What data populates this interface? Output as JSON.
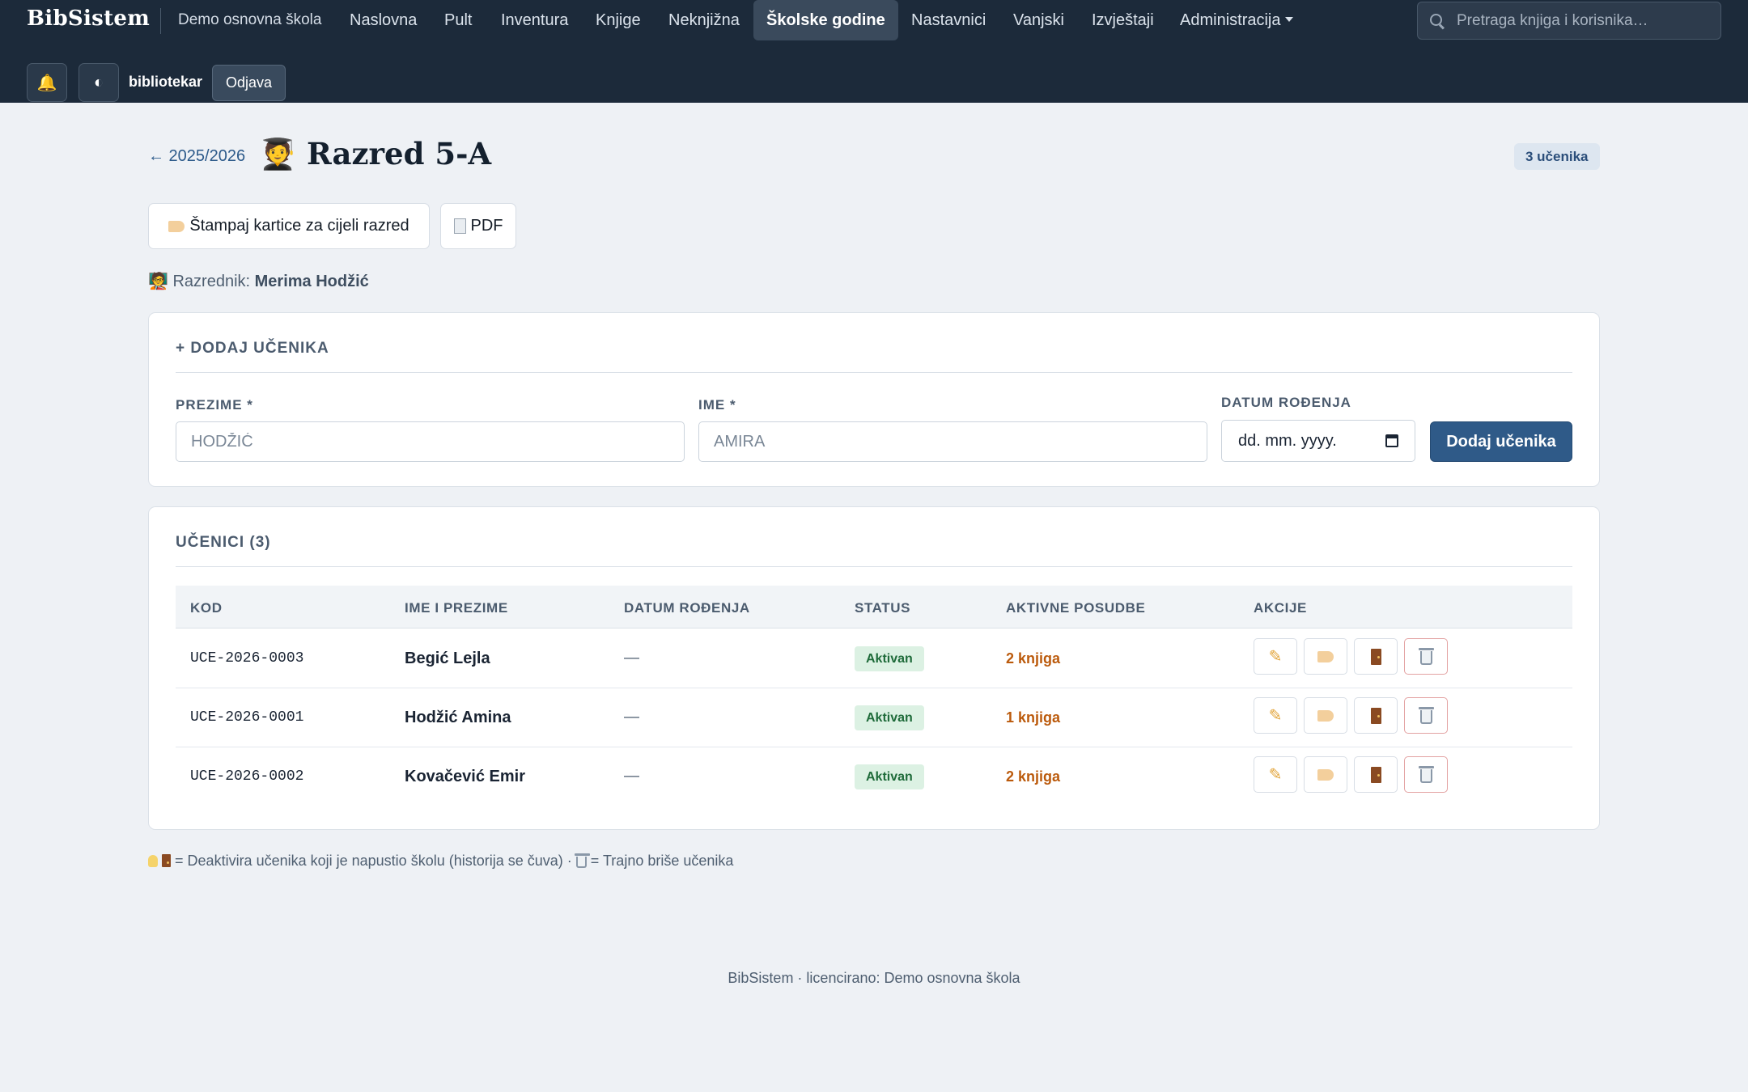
{
  "app": {
    "brand": "BibSistem",
    "school": "Demo osnovna škola"
  },
  "nav": {
    "items": [
      {
        "label": "Naslovna"
      },
      {
        "label": "Pult"
      },
      {
        "label": "Inventura"
      },
      {
        "label": "Knjige"
      },
      {
        "label": "Neknjižna"
      },
      {
        "label": "Školske godine"
      },
      {
        "label": "Nastavnici"
      },
      {
        "label": "Vanjski"
      },
      {
        "label": "Izvještaji"
      },
      {
        "label": "Administracija"
      }
    ],
    "active": "Školske godine",
    "search_placeholder": "Pretraga knjiga i korisnika…"
  },
  "user_bar": {
    "notifications_icon": "bell-icon",
    "theme_icon": "contrast-icon",
    "username": "bibliotekar",
    "logout_label": "Odjava"
  },
  "header": {
    "back_label": "← 2025/2026",
    "title": "🧑‍🎓 Razred 5-A",
    "count_badge": "3 učenika",
    "print_cards_label": "Štampaj kartice za cijeli razred",
    "pdf_label": "PDF",
    "teacher_label": "Razrednik:",
    "teacher_name": "Merima Hodžić",
    "teacher_icon": "🧑‍🏫"
  },
  "add_form": {
    "title": "+ DODAJ UČENIKA",
    "surname_label": "PREZIME *",
    "surname_placeholder": "HODŽIĆ",
    "name_label": "IME *",
    "name_placeholder": "AMIRA",
    "dob_label": "DATUM ROĐENJA",
    "dob_placeholder": "dd. mm. yyyy.",
    "submit_label": "Dodaj učenika"
  },
  "students": {
    "title": "UČENICI (3)",
    "columns": [
      "KOD",
      "IME I PREZIME",
      "DATUM ROĐENJA",
      "STATUS",
      "AKTIVNE POSUDBE",
      "AKCIJE"
    ],
    "rows": [
      {
        "code": "UCE-2026-0003",
        "name": "Begić Lejla",
        "dob": "—",
        "status": "Aktivan",
        "loans": "2 knjiga"
      },
      {
        "code": "UCE-2026-0001",
        "name": "Hodžić Amina",
        "dob": "—",
        "status": "Aktivan",
        "loans": "1 knjiga"
      },
      {
        "code": "UCE-2026-0002",
        "name": "Kovačević Emir",
        "dob": "—",
        "status": "Aktivan",
        "loans": "2 knjiga"
      }
    ],
    "row_actions": [
      "edit-icon",
      "card-tag-icon",
      "door-icon",
      "trash-icon"
    ]
  },
  "note": {
    "part1": "= Deaktivira učenika koji je napustio školu (historija se čuva) ·",
    "part2": "= Trajno briše učenika"
  },
  "footer": {
    "text": "BibSistem · licencirano: Demo osnovna škola"
  },
  "colors": {
    "topbar": "#1c2a3a",
    "primary": "#2f5a88",
    "loans": "#bb5a0c",
    "status_bg": "#dcf1e3",
    "status_text": "#1f6b3a"
  }
}
